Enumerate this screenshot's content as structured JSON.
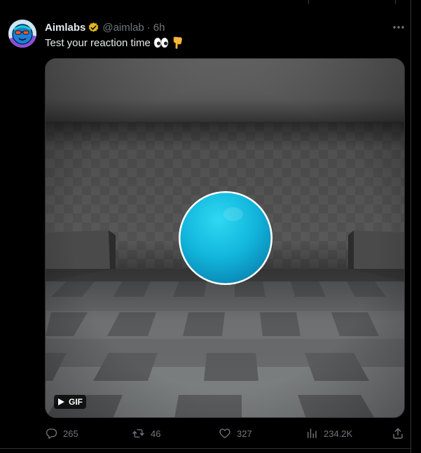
{
  "tweet": {
    "author_name": "Aimlabs",
    "handle": "@aimlab",
    "separator": "·",
    "time": "6h",
    "text": "Test your reaction time"
  },
  "media": {
    "badge_label": "GIF",
    "target_color": "#12b6dc",
    "icons": [
      "play-icon"
    ]
  },
  "actions": {
    "replies": "265",
    "reposts": "46",
    "likes": "327",
    "views": "234.2K"
  },
  "colors": {
    "background": "#000000",
    "text": "#e7e9ea",
    "muted": "#71767b",
    "verified": "#e2b719"
  }
}
